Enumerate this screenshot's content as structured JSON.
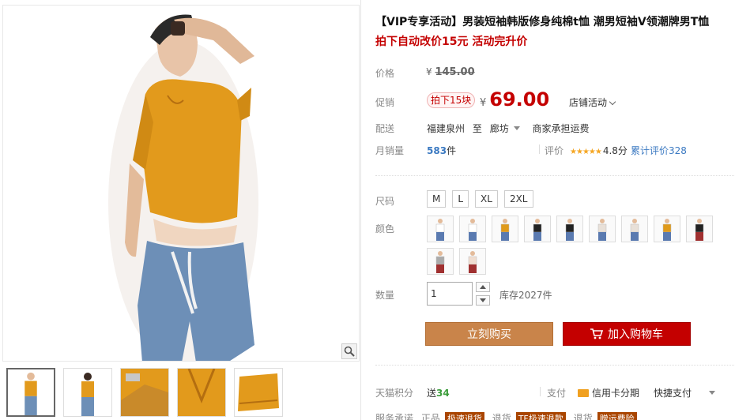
{
  "product": {
    "title": "【VIP专享活动】男装短袖韩版修身纯棉t恤 潮男短袖V领潮牌男T恤",
    "subtitle": "拍下自动改价15元 活动完升价"
  },
  "price": {
    "label": "价格",
    "currency": "¥",
    "original": "145.00",
    "promo_label": "促销",
    "promo_tag": "拍下15块",
    "promo_price": "69.00",
    "shop_activity": "店铺活动"
  },
  "shipping": {
    "label": "配送",
    "origin": "福建泉州",
    "to": "至",
    "destination": "廊坊",
    "fee": "商家承担运费"
  },
  "sales": {
    "label": "月销量",
    "count": "583",
    "unit": "件",
    "rating_label": "评价",
    "stars": "★★★★★",
    "score": "4.8分",
    "reviews": "累计评价328"
  },
  "sizes": {
    "label": "尺码",
    "options": [
      "M",
      "L",
      "XL",
      "2XL"
    ]
  },
  "colors": {
    "label": "颜色",
    "swatches": [
      {
        "shirt": "#ffffff",
        "pants": "#5a7ab0",
        "icon": "white-tee-swatch-icon"
      },
      {
        "shirt": "#ffffff",
        "pants": "#5a7ab0",
        "icon": "white-tee-swatch-icon"
      },
      {
        "shirt": "#e09a1a",
        "pants": "#5a7ab0",
        "icon": "orange-tee-swatch-icon"
      },
      {
        "shirt": "#222222",
        "pants": "#5a7ab0",
        "icon": "black-tee-swatch-icon"
      },
      {
        "shirt": "#222222",
        "pants": "#5a7ab0",
        "icon": "black-tee-swatch-icon"
      },
      {
        "shirt": "#e8e0d8",
        "pants": "#5a7ab0",
        "icon": "beige-tee-swatch-icon"
      },
      {
        "shirt": "#e8e0d8",
        "pants": "#5a7ab0",
        "icon": "beige-tee-swatch-icon"
      },
      {
        "shirt": "#e09a1a",
        "pants": "#5a7ab0",
        "icon": "orange-tee-swatch-icon"
      },
      {
        "shirt": "#222222",
        "pants": "#a03030",
        "icon": "black-tee-swatch-icon"
      },
      {
        "shirt": "#aaaaaa",
        "pants": "#a03030",
        "icon": "gray-tee-swatch-icon"
      },
      {
        "shirt": "#f0ddd0",
        "pants": "#a03030",
        "icon": "pink-tee-swatch-icon"
      }
    ]
  },
  "quantity": {
    "label": "数量",
    "value": "1",
    "stock": "库存2027件"
  },
  "actions": {
    "buy_now": "立刻购买",
    "add_to_cart": "加入购物车"
  },
  "extras": {
    "points_label": "天猫积分",
    "points_prefix": "送",
    "points_value": "34",
    "pay_label": "支付",
    "card_pay": "信用卡分期",
    "quick_pay": "快捷支付"
  },
  "service": {
    "label": "服务承诺",
    "item1": "正品",
    "badge1": "极速退货",
    "item2": "退货",
    "badge2": "TF极速退款",
    "item3": "退货",
    "badge3": "赠运费险"
  },
  "theme": {
    "brand_red": "#c40000",
    "buy_color": "#c9844a",
    "link_blue": "#3c7ac2"
  },
  "gallery": {
    "thumb_count": 5
  }
}
